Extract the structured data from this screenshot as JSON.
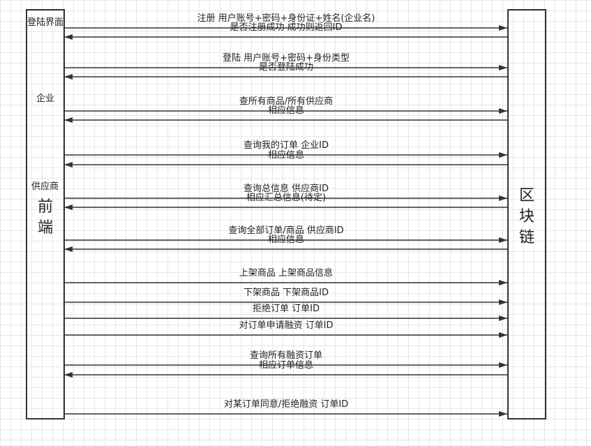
{
  "left": {
    "title": "登陆界面",
    "enterprise": "企业",
    "supplier": "供应商",
    "frontend_1": "前",
    "frontend_2": "端"
  },
  "right": {
    "char_1": "区",
    "char_2": "块",
    "char_3": "链"
  },
  "messages": [
    {
      "text": "注册 用户账号+密码+身份证+姓名(企业名)",
      "dir": "right"
    },
    {
      "text": "是否注册成功 成功则返回ID",
      "dir": "left"
    },
    {
      "text": "登陆 用户账号+密码+身份类型",
      "dir": "right"
    },
    {
      "text": "是否登陆成功",
      "dir": "left"
    },
    {
      "text": "查所有商品/所有供应商",
      "dir": "right"
    },
    {
      "text": "相应信息",
      "dir": "left"
    },
    {
      "text": "查询我的订单 企业ID",
      "dir": "right"
    },
    {
      "text": "相应信息",
      "dir": "left"
    },
    {
      "text": "查询总信息 供应商ID",
      "dir": "right"
    },
    {
      "text": "相应汇总信息(待定)",
      "dir": "left"
    },
    {
      "text": "查询全部订单/商品 供应商ID",
      "dir": "right"
    },
    {
      "text": "相应信息",
      "dir": "left"
    },
    {
      "text": "上架商品 上架商品信息",
      "dir": "right"
    },
    {
      "text": "下架商品 下架商品ID",
      "dir": "right"
    },
    {
      "text": "拒绝订单 订单ID",
      "dir": "right"
    },
    {
      "text": "对订单申请融资 订单ID",
      "dir": "right"
    },
    {
      "text": "查询所有融资订单",
      "dir": "right"
    },
    {
      "text": "相应订单信息",
      "dir": "left"
    },
    {
      "text": "对某订单同意/拒绝融资 订单ID",
      "dir": "right"
    }
  ]
}
